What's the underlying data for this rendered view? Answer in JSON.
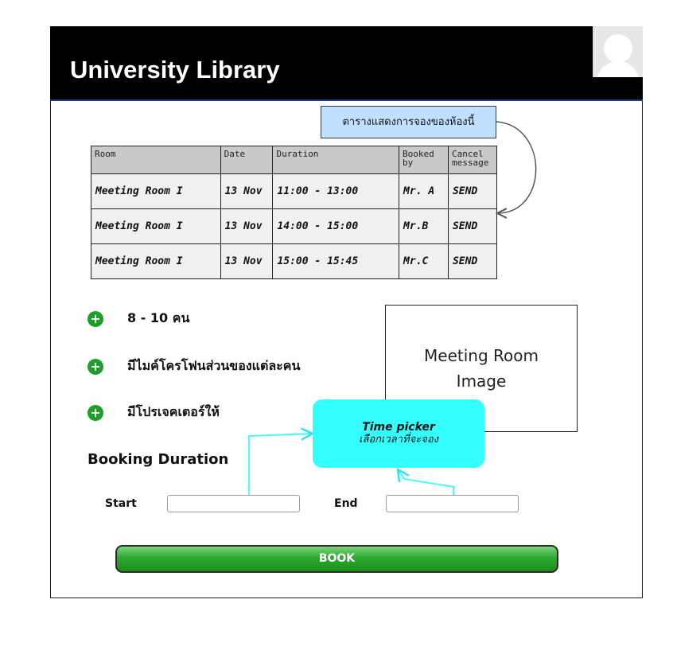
{
  "header": {
    "title": "University Library",
    "avatar_icon": "user-avatar-icon"
  },
  "annotation_note": "ตารางแสดงการจองของห้องนี้",
  "table": {
    "headers": [
      "Room",
      "Date",
      "Duration",
      "Booked by",
      "Cancel message"
    ],
    "rows": [
      [
        "Meeting Room I",
        "13 Nov",
        "11:00 - 13:00",
        "Mr. A",
        "SEND"
      ],
      [
        "Meeting Room I",
        "13 Nov",
        "14:00 - 15:00",
        "Mr.B",
        "SEND"
      ],
      [
        "Meeting Room I",
        "13 Nov",
        "15:00 - 15:45",
        "Mr.C",
        "SEND"
      ]
    ]
  },
  "features": [
    {
      "icon": "plus-circle-icon",
      "text": "8 - 10 คน"
    },
    {
      "icon": "plus-circle-icon",
      "text": "มีไมค์โครโฟนส่วนของแต่ละคน"
    },
    {
      "icon": "plus-circle-icon",
      "text": "มีโปรเจคเตอร์ให้"
    }
  ],
  "room_image": {
    "line1": "Meeting Room",
    "line2": "Image"
  },
  "time_picker": {
    "title": "Time picker",
    "subtitle": "เลือกเวลาที่จะจอง",
    "color": "#33ffff"
  },
  "booking": {
    "section_title": "Booking Duration",
    "start_label": "Start",
    "start_value": "",
    "end_label": "End",
    "end_value": "",
    "button_label": "BOOK"
  },
  "colors": {
    "header_bg": "#000000",
    "note_bg": "#bfe0ff",
    "accent_green": "#1e9e2a"
  }
}
